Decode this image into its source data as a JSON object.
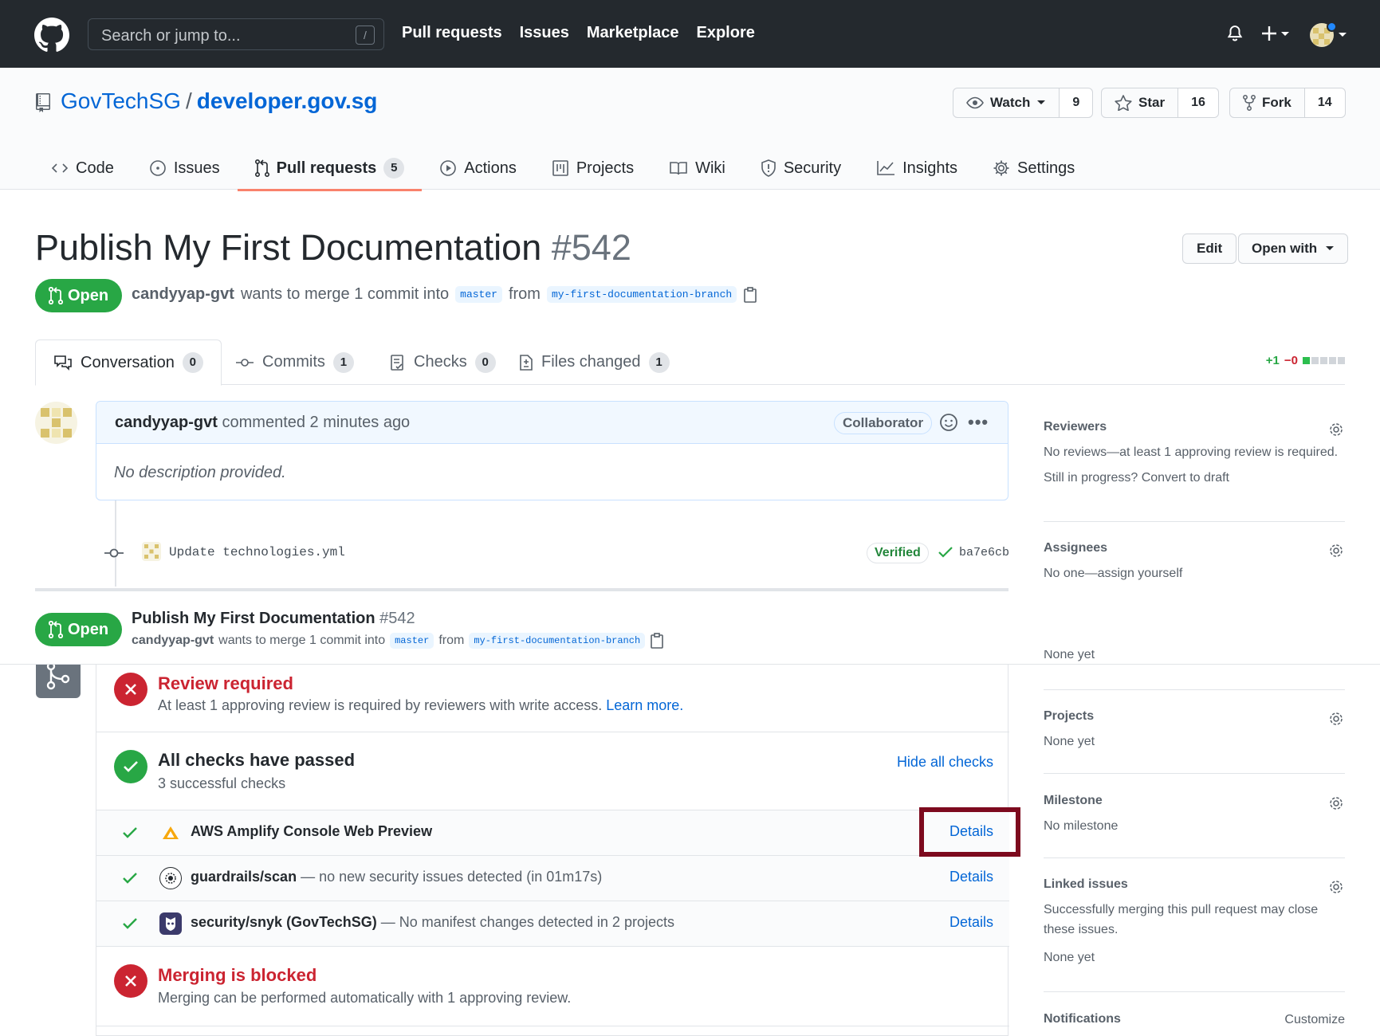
{
  "header": {
    "search_placeholder": "Search or jump to...",
    "search_shortcut": "/",
    "nav": [
      "Pull requests",
      "Issues",
      "Marketplace",
      "Explore"
    ],
    "icons": [
      "github-logo",
      "bell-icon",
      "plus-icon",
      "avatar"
    ]
  },
  "repo": {
    "owner": "GovTechSG",
    "separator": "/",
    "name": "developer.gov.sg",
    "watch_label": "Watch",
    "watch_count": "9",
    "star_label": "Star",
    "star_count": "16",
    "fork_label": "Fork",
    "fork_count": "14",
    "nav": [
      {
        "label": "Code",
        "icon": "code-icon"
      },
      {
        "label": "Issues",
        "icon": "issue-icon"
      },
      {
        "label": "Pull requests",
        "icon": "pull-request-icon",
        "count": "5",
        "active": true
      },
      {
        "label": "Actions",
        "icon": "play-icon"
      },
      {
        "label": "Projects",
        "icon": "project-icon"
      },
      {
        "label": "Wiki",
        "icon": "book-icon"
      },
      {
        "label": "Security",
        "icon": "shield-icon"
      },
      {
        "label": "Insights",
        "icon": "graph-icon"
      },
      {
        "label": "Settings",
        "icon": "gear-icon"
      }
    ]
  },
  "pr": {
    "title": "Publish My First Documentation",
    "number": "#542",
    "edit_label": "Edit",
    "open_with_label": "Open with",
    "state": "Open",
    "author": "candyyap-gvt",
    "merge_text": "wants to merge 1 commit into",
    "base_branch": "master",
    "from_text": "from",
    "head_branch": "my-first-documentation-branch"
  },
  "tabs": [
    {
      "label": "Conversation",
      "count": "0",
      "icon": "comment-discussion-icon"
    },
    {
      "label": "Commits",
      "count": "1",
      "icon": "commit-icon"
    },
    {
      "label": "Checks",
      "count": "0",
      "icon": "checklist-icon"
    },
    {
      "label": "Files changed",
      "count": "1",
      "icon": "diff-icon"
    }
  ],
  "diffstat": {
    "additions": "+1",
    "deletions": "−0",
    "color_add": "#28a745",
    "color_del": "#cb2431"
  },
  "comment": {
    "author": "candyyap-gvt",
    "action": "commented 2 minutes ago",
    "badge": "Collaborator",
    "body": "No description provided."
  },
  "commit": {
    "message": "Update technologies.yml",
    "verified": "Verified",
    "sha": "ba7e6cb"
  },
  "sticky": {
    "state": "Open",
    "title": "Publish My First Documentation",
    "number": "#542",
    "author": "candyyap-gvt",
    "merge_text": "wants to merge 1 commit into",
    "base_branch": "master",
    "from_text": "from",
    "head_branch": "my-first-documentation-branch"
  },
  "sidebar": {
    "reviewers_title": "Reviewers",
    "reviewers_text": "No reviews—at least 1 approving review is required.",
    "reviewers_draft": "Still in progress? Convert to draft",
    "assignees_title": "Assignees",
    "assignees_text": "No one—assign yourself",
    "labels_partial": "None yet",
    "projects_title": "Projects",
    "projects_text": "None yet",
    "milestone_title": "Milestone",
    "milestone_text": "No milestone",
    "linked_title": "Linked issues",
    "linked_text": "Successfully merging this pull request may close these issues.",
    "linked_none": "None yet",
    "notifications_title": "Notifications",
    "notifications_action": "Customize"
  },
  "mergebox": {
    "review_title": "Review required",
    "review_text": "At least 1 approving review is required by reviewers with write access.",
    "review_link": "Learn more.",
    "checks_title": "All checks have passed",
    "checks_sub": "3 successful checks",
    "hide_checks": "Hide all checks",
    "checks": [
      {
        "name": "AWS Amplify Console Web Preview",
        "desc": "",
        "details": "Details",
        "icon": "aws-amplify-icon"
      },
      {
        "name": "guardrails/scan",
        "desc": "— no new security issues detected (in 01m17s)",
        "details": "Details",
        "icon": "guardrails-icon"
      },
      {
        "name": "security/snyk (GovTechSG)",
        "desc": "— No manifest changes detected in 2 projects",
        "details": "Details",
        "icon": "snyk-icon"
      }
    ],
    "blocked_title": "Merging is blocked",
    "blocked_text": "Merging can be performed automatically with 1 approving review."
  },
  "colors": {
    "header_bg": "#24292e",
    "green": "#28a745",
    "red": "#cb2431",
    "link": "#0366d6",
    "highlight": "#7d0a1e"
  }
}
